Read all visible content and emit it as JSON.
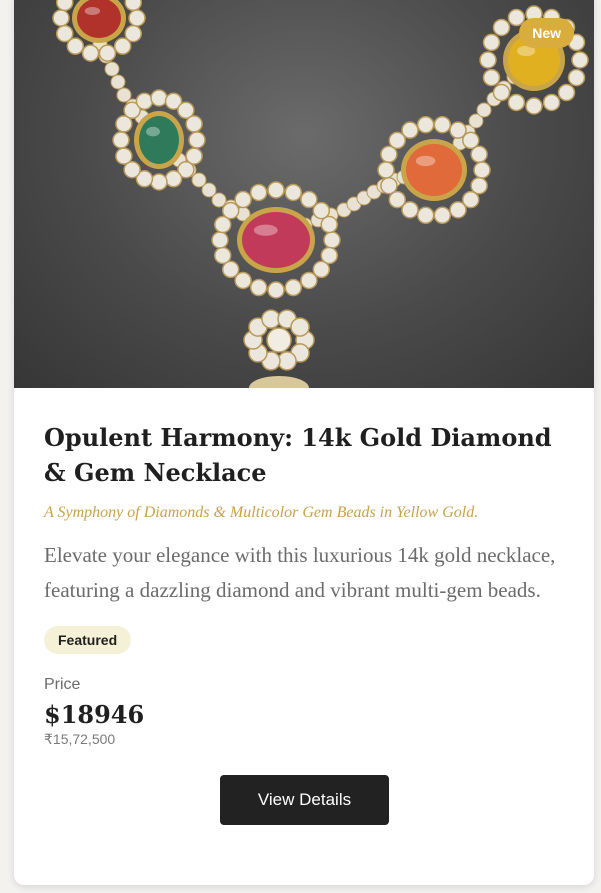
{
  "product": {
    "badge": "New",
    "title": "Opulent Harmony: 14k Gold Diamond & Gem Necklace",
    "subtitle": "A Symphony of Diamonds & Multicolor Gem Beads in Yellow Gold.",
    "description": "Elevate your elegance with this luxurious 14k gold necklace, featuring a dazzling diamond and vibrant multi-gem beads.",
    "tag": "Featured",
    "price_label": "Price",
    "price_usd": "$18946",
    "price_inr": "₹15,72,500",
    "cta": "View Details"
  },
  "colors": {
    "accent_gold": "#d8ad3e",
    "subtitle_gold": "#c9a24b",
    "button_dark": "#222222",
    "tag_bg": "#f4f1d6"
  },
  "image": {
    "icon": "necklace-photo"
  }
}
